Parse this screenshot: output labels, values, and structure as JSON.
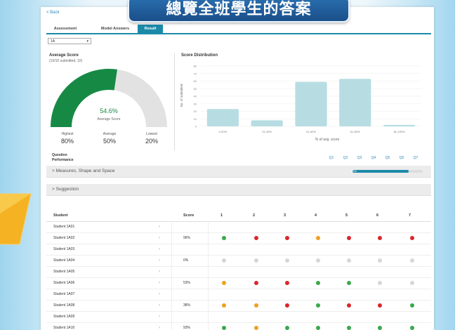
{
  "banner": {
    "title": "總覽全班學生的答案"
  },
  "nav": {
    "back": "< Back"
  },
  "tabs": [
    {
      "label": "Assessment",
      "active": false
    },
    {
      "label": "Model Answers",
      "active": false
    },
    {
      "label": "Result",
      "active": true
    }
  ],
  "class_select": {
    "value": "1A"
  },
  "average": {
    "title": "Average Score",
    "submitted": "(10/10 submitted, 10)",
    "percent": "54.6%",
    "caption": "Average Score",
    "fraction": 0.546,
    "highest": {
      "label": "Highest",
      "value": "80%"
    },
    "avg": {
      "label": "Average",
      "value": "50%"
    },
    "lowest": {
      "label": "Lowest",
      "value": "20%"
    },
    "colors": {
      "fill": "#168a45",
      "track": "#e2e2e2"
    }
  },
  "chart_data": {
    "type": "bar",
    "title": "Score Distribution",
    "ylabel": "No. of submitted",
    "xlabel": "% of avg. score",
    "categories": [
      "0-20%",
      "21-40%",
      "41-60%",
      "61-80%",
      "81-100%"
    ],
    "values": [
      23,
      8,
      59,
      63,
      2
    ],
    "ylim": [
      0,
      80
    ],
    "yticks": [
      0,
      10,
      20,
      30,
      40,
      50,
      60,
      70,
      80
    ],
    "color": "#b7dde3",
    "grid": true
  },
  "question_perf": {
    "label_line1": "Question",
    "label_line2": "Performance",
    "questions": [
      "Q1",
      "Q2",
      "Q3",
      "Q4",
      "Q5",
      "Q6",
      "Q7"
    ]
  },
  "sections": [
    {
      "label": "> Measures, Shape and Space",
      "progress": 0.8,
      "progress_label": "80%"
    },
    {
      "label": "> Suggestion"
    }
  ],
  "table": {
    "headers": {
      "student": "Student",
      "score": "Score",
      "questions": [
        "1",
        "2",
        "3",
        "4",
        "5",
        "6",
        "7"
      ]
    },
    "colors": {
      "green": "#3aa84a",
      "red": "#d9262b",
      "orange": "#f0a020",
      "gray": "#d6d6d6"
    },
    "rows": [
      {
        "name": "Student 1A01",
        "score": "",
        "answers": []
      },
      {
        "name": "Student 1A02",
        "score": "96%",
        "answers": [
          "green",
          "red",
          "red",
          "orange",
          "red",
          "red",
          "red"
        ]
      },
      {
        "name": "Student 1A03",
        "score": "",
        "answers": []
      },
      {
        "name": "Student 1A04",
        "score": "0%",
        "answers": [
          "gray",
          "gray",
          "gray",
          "gray",
          "gray",
          "gray",
          "gray"
        ]
      },
      {
        "name": "Student 1A05",
        "score": "",
        "answers": []
      },
      {
        "name": "Student 1A06",
        "score": "53%",
        "answers": [
          "orange",
          "red",
          "red",
          "green",
          "green",
          "gray",
          "gray"
        ]
      },
      {
        "name": "Student 1A07",
        "score": "",
        "answers": []
      },
      {
        "name": "Student 1A08",
        "score": "38%",
        "answers": [
          "orange",
          "orange",
          "red",
          "green",
          "red",
          "red",
          "green"
        ]
      },
      {
        "name": "Student 1A09",
        "score": "",
        "answers": []
      },
      {
        "name": "Student 1A10",
        "score": "93%",
        "answers": [
          "green",
          "orange",
          "green",
          "green",
          "green",
          "green",
          "green"
        ]
      }
    ]
  }
}
